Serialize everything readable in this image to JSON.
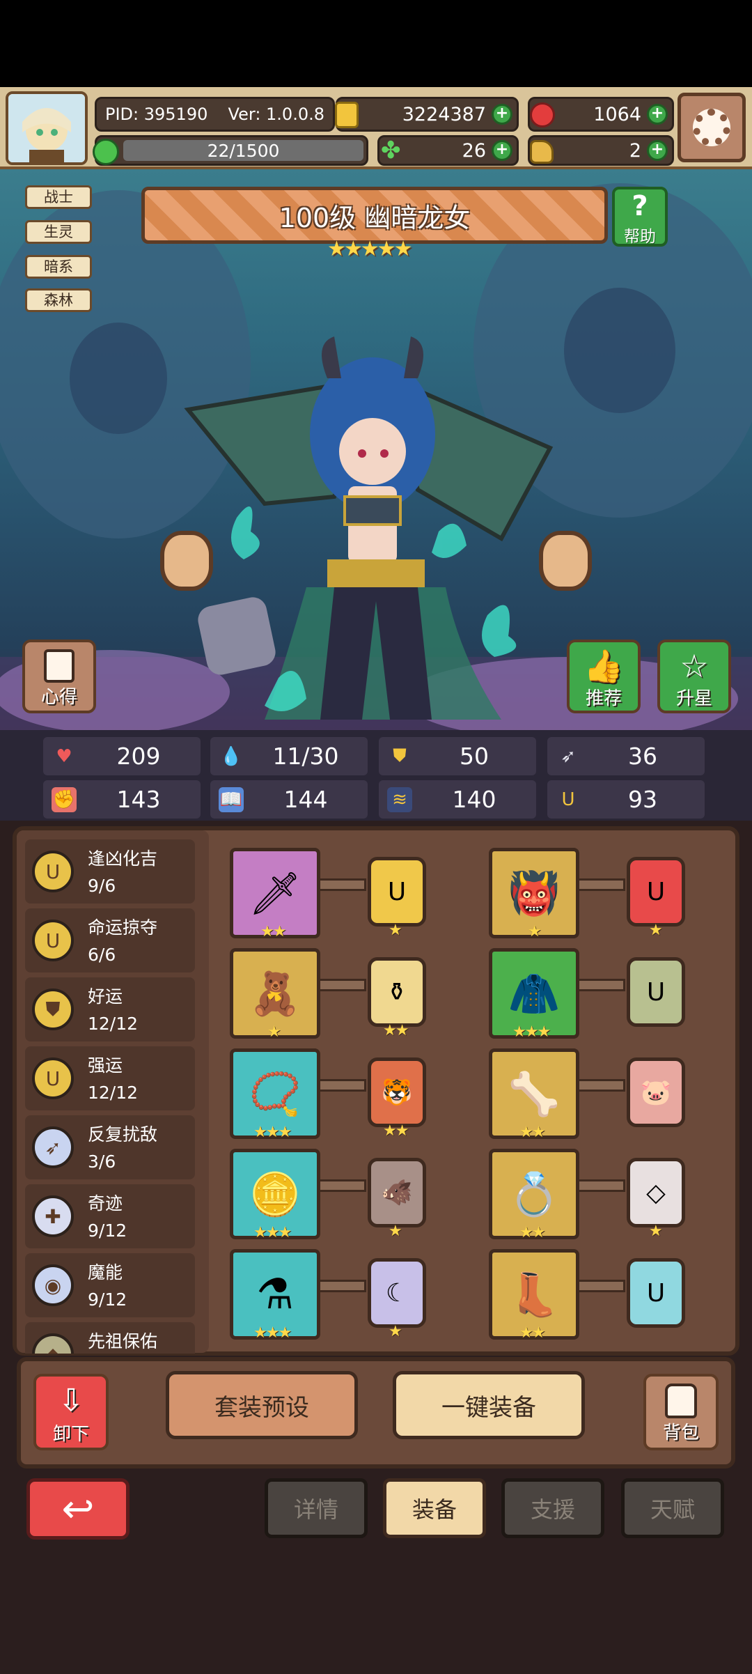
{
  "header": {
    "pid": "PID: 395190",
    "version": "Ver: 1.0.0.8",
    "gold": "3224387",
    "rubies": "1064",
    "stamina": "22/1500",
    "clover": "26",
    "keys": "2"
  },
  "tags": [
    "战士",
    "生灵",
    "暗系",
    "森林"
  ],
  "hero": {
    "title": "100级  幽暗龙女",
    "stars": 5
  },
  "buttons": {
    "help": "帮助",
    "notes": "心得",
    "recommend": "推荐",
    "starup": "升星",
    "unequip": "卸下",
    "preset": "套装预设",
    "auto_equip": "一键装备",
    "bag": "背包"
  },
  "stats": {
    "hp": "209",
    "mana": "11/30",
    "armor": "50",
    "speed": "36",
    "attack": "143",
    "magic": "144",
    "crit": "140",
    "luck": "93"
  },
  "sets": [
    {
      "name": "逢凶化吉",
      "count": "9/6"
    },
    {
      "name": "命运掠夺",
      "count": "6/6"
    },
    {
      "name": "好运",
      "count": "12/12"
    },
    {
      "name": "强运",
      "count": "12/12"
    },
    {
      "name": "反复扰敌",
      "count": "3/6"
    },
    {
      "name": "奇迹",
      "count": "9/12"
    },
    {
      "name": "魔能",
      "count": "9/12"
    },
    {
      "name": "先祖保佑",
      "count": ""
    }
  ],
  "equipment": [
    {
      "item": "sword",
      "item_stars": 2,
      "gem_stars": 1
    },
    {
      "item": "helmet",
      "item_stars": 1,
      "gem_stars": 1
    },
    {
      "item": "teddy-bear",
      "item_stars": 1,
      "gem_stars": 2
    },
    {
      "item": "cloak",
      "item_stars": 3,
      "gem_stars": 0
    },
    {
      "item": "necklace",
      "item_stars": 3,
      "gem_stars": 2
    },
    {
      "item": "bone-wand",
      "item_stars": 2,
      "gem_stars": 0
    },
    {
      "item": "coin-amulet",
      "item_stars": 3,
      "gem_stars": 1
    },
    {
      "item": "crown-ring",
      "item_stars": 2,
      "gem_stars": 1
    },
    {
      "item": "potion",
      "item_stars": 3,
      "gem_stars": 1
    },
    {
      "item": "boots",
      "item_stars": 2,
      "gem_stars": 0
    }
  ],
  "tabs": [
    "详情",
    "装备",
    "支援",
    "天赋"
  ],
  "active_tab": "装备"
}
